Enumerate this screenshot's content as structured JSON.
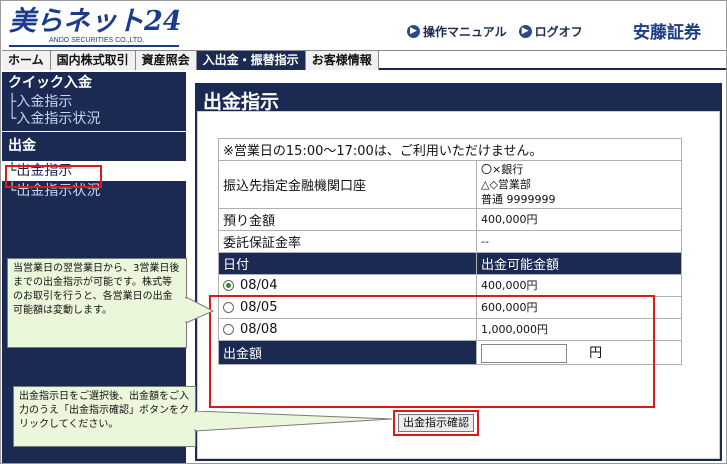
{
  "header": {
    "logo_text": "美らネット24",
    "logo_sub": "ANDO SECURITIES CO.,LTD.",
    "manual_label": "操作マニュアル",
    "logout_label": "ログオフ",
    "brand": "安藤証券",
    "link_icon": "arrow-circle-icon"
  },
  "nav": {
    "tabs": [
      {
        "label": "ホーム"
      },
      {
        "label": "国内株式取引"
      },
      {
        "label": "資産照会"
      },
      {
        "label": "入出金・振替指示",
        "active": true
      },
      {
        "label": "お客様情報"
      }
    ]
  },
  "sidebar": {
    "quick_heading": "クイック入金",
    "quick_items": [
      "├入金指示",
      "└入金指示状況"
    ],
    "withdraw_heading": "出金",
    "withdraw_active": "└出金指示",
    "withdraw_items": [
      "└出金指示状況"
    ]
  },
  "main": {
    "title": "出金指示",
    "notice": "※営業日の15:00〜17:00は、ご利用いただけません。",
    "bank_label": "振込先指定金融機関口座",
    "bank_lines": [
      "〇×銀行",
      "△◇営業部",
      "普通 9999999"
    ],
    "deposit_label": "預り金額",
    "deposit_value": "400,000円",
    "margin_label": "委託保証金率",
    "margin_value": "--",
    "date_header": "日付",
    "amount_header": "出金可能金額",
    "dates": [
      {
        "date": "08/04",
        "amount": "400,000円",
        "selected": true
      },
      {
        "date": "08/05",
        "amount": "600,000円",
        "selected": false
      },
      {
        "date": "08/08",
        "amount": "1,000,000円",
        "selected": false
      }
    ],
    "withdraw_amount_label": "出金額",
    "withdraw_amount_value": "",
    "yen_unit": "円",
    "confirm_button": "出金指示確認"
  },
  "callouts": {
    "upper": "当営業日の翌営業日から、3営業日後までの出金指示が可能です。株式等のお取引を行うと、各営業日の出金可能額は変動します。",
    "lower": "出金指示日をご選択後、出金額をご入力のうえ「出金指示確認」ボタンをクリックしてください。"
  },
  "colors": {
    "navy": "#1a2a52",
    "highlight_red": "#e01818",
    "callout_bg": "#ebf7da"
  }
}
